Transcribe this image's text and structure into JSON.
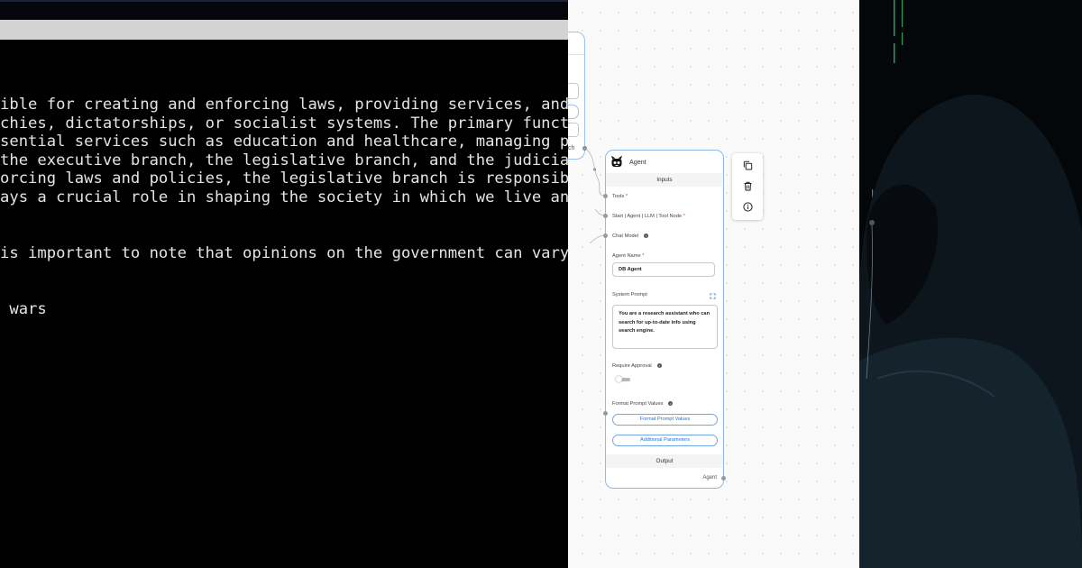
{
  "terminal": {
    "lines": [
      "ible for creating and enforcing laws, providing services, and",
      "chies, dictatorships, or socialist systems. The primary funct",
      "sential services such as education and healthcare, managing p",
      "the executive branch, the legislative branch, and the judicia",
      "orcing laws and policies, the legislative branch is responsib",
      "ays a crucial role in shaping the society in which we live an",
      "is important to note that opinions on the government can vary",
      " wars"
    ],
    "colors": {
      "background": "#000000",
      "text": "#e4e4e4",
      "input_bar": "#d3d3d3"
    }
  },
  "flow": {
    "previous_node": {
      "output_tail": "ch"
    },
    "agent_node": {
      "icon": "robot-icon",
      "title": "Agent",
      "inputs_header": "Inputs",
      "tools_label": "Tools",
      "start_label": "Start | Agent | LLM | Tool Node",
      "chat_model_label": "Chat Model",
      "agent_name_label": "Agent Name",
      "agent_name_value": "DB Agent",
      "system_prompt_label": "System Prompt",
      "system_prompt_value": "You are a research assistant who can search for up-to-date info using search engine.",
      "require_approval_label": "Require Approval",
      "require_approval_on": false,
      "format_prompt_values_label": "Format Prompt Values",
      "format_prompt_values_button": "Format Prompt Values",
      "additional_parameters_button": "Additional Parameters",
      "output_header": "Output",
      "output_label": "Agent",
      "required_marker": "*",
      "accent": "#1976d2"
    },
    "toolbar": {
      "icons": [
        "copy-icon",
        "trash-icon",
        "info-icon"
      ]
    }
  }
}
